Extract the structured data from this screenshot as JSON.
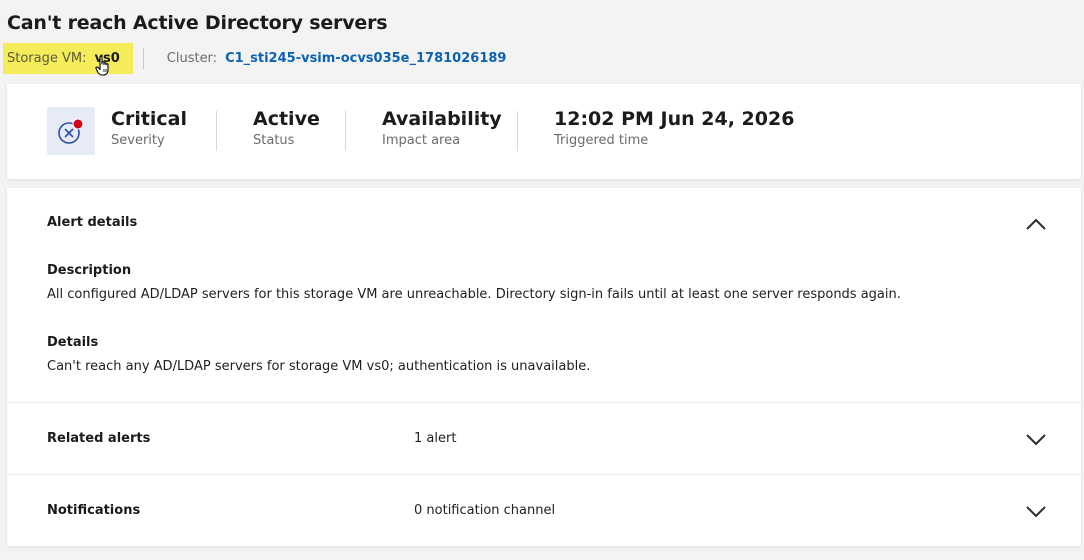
{
  "header": {
    "title": "Can't reach Active Directory servers",
    "storage_vm_label": "Storage VM:",
    "storage_vm_value": "vs0",
    "cluster_label": "Cluster:",
    "cluster_value": "C1_sti245-vsim-ocvs035e_1781026189"
  },
  "summary": {
    "severity_icon": "critical-x-circle-icon",
    "severity_value": "Critical",
    "severity_label": "Severity",
    "status_value": "Active",
    "status_label": "Status",
    "impact_value": "Availability",
    "impact_label": "Impact area",
    "triggered_value": "12:02 PM Jun 24, 2026",
    "triggered_label": "Triggered time"
  },
  "alert_details": {
    "title": "Alert details",
    "description_heading": "Description",
    "description_text": "All configured AD/LDAP servers for this storage VM are unreachable. Directory sign-in fails until at least one server responds again.",
    "details_heading": "Details",
    "details_text": "Can't reach any AD/LDAP servers for storage VM vs0; authentication is unavailable."
  },
  "related_alerts": {
    "title": "Related alerts",
    "value": "1 alert"
  },
  "notifications": {
    "title": "Notifications",
    "value": "0 notification channel"
  },
  "colors": {
    "highlight": "#f5ec5c",
    "link": "#0b62b3",
    "critical_dot": "#d0021b",
    "icon_stroke": "#2f4fa8",
    "icon_bg": "#e6ebf6"
  }
}
